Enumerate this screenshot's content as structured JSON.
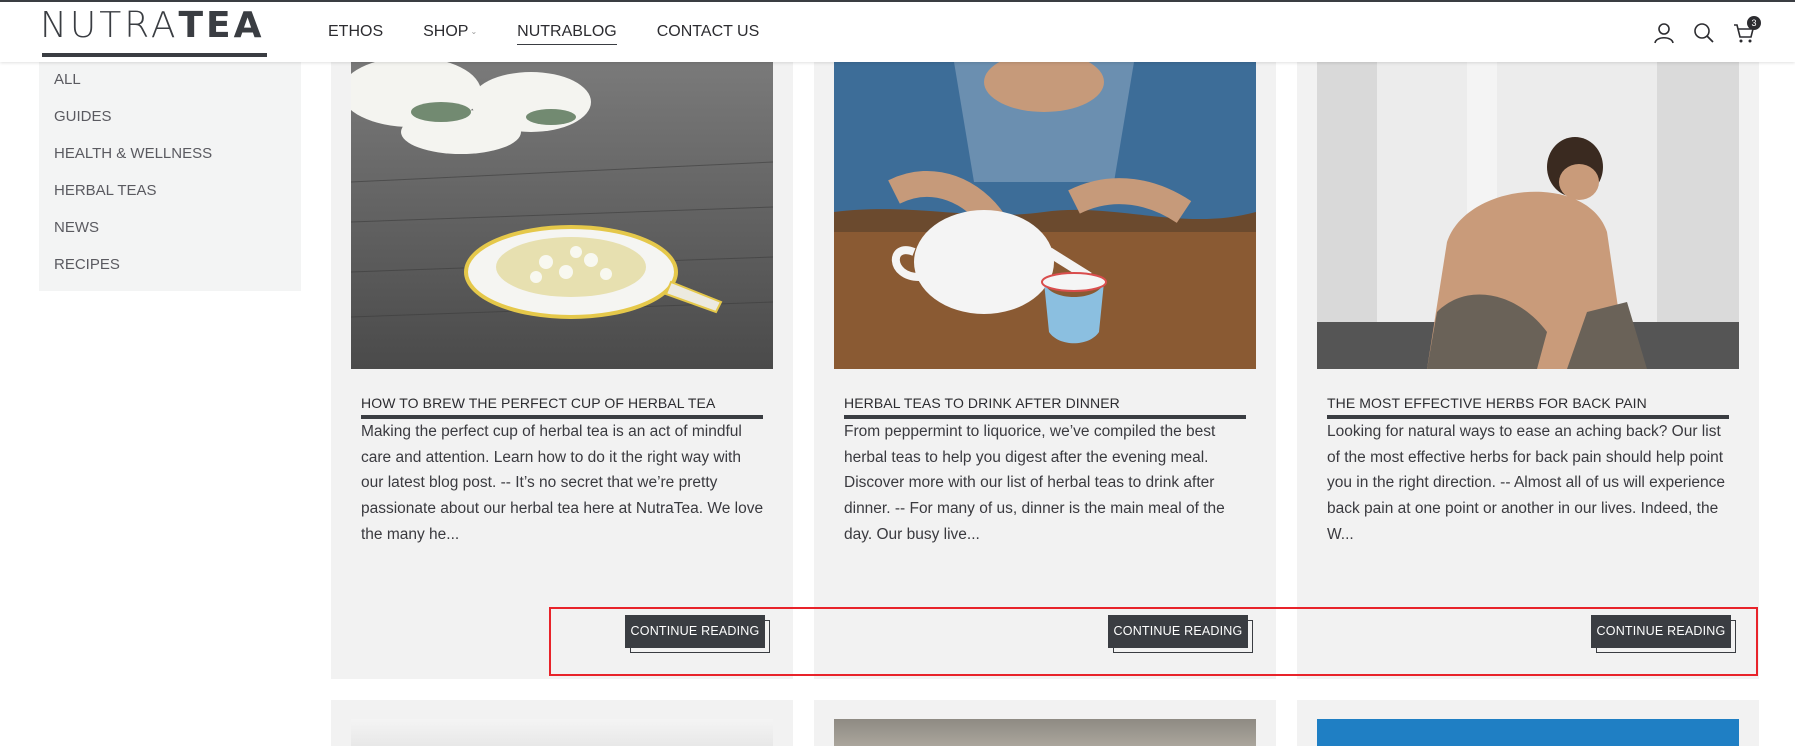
{
  "header": {
    "logo_thin": "NUTRA",
    "logo_bold": "TEA",
    "nav": [
      {
        "label": "ETHOS"
      },
      {
        "label": "SHOP"
      },
      {
        "label": "NUTRABLOG"
      },
      {
        "label": "CONTACT US"
      }
    ],
    "cart_count": "3"
  },
  "sidebar": {
    "items": [
      {
        "label": "ALL"
      },
      {
        "label": "GUIDES"
      },
      {
        "label": "HEALTH & WELLNESS"
      },
      {
        "label": "HERBAL TEAS"
      },
      {
        "label": "NEWS"
      },
      {
        "label": "RECIPES"
      }
    ]
  },
  "posts": [
    {
      "title": "HOW TO BREW THE PERFECT CUP OF HERBAL TEA",
      "excerpt": "Making the perfect cup of herbal tea is an act of mindful care and attention. Learn how to do it the right way with our latest blog post.  -- It’s no secret that we’re pretty passionate about our herbal tea here at NutraTea. We love the many he...",
      "button": "CONTINUE READING"
    },
    {
      "title": "HERBAL TEAS TO DRINK AFTER DINNER",
      "excerpt": "From peppermint to liquorice, we’ve compiled the best herbal teas to help you digest after the evening meal. Discover more with our list of herbal teas to drink after dinner.  -- For many of us, dinner is the main meal of the day. Our busy live...",
      "button": "CONTINUE READING"
    },
    {
      "title": "THE MOST EFFECTIVE HERBS FOR BACK PAIN",
      "excerpt": "Looking for natural ways to ease an aching back? Our list of the most effective herbs for back pain should help point you in the right direction.  -- Almost all of us will experience back pain at one point or another in our lives. Indeed, the W...",
      "button": "CONTINUE READING"
    }
  ],
  "colors": {
    "brand_dark": "#3a3d42",
    "card_bg": "#f2f2f2",
    "sidebar_bg": "#f3f4f4",
    "highlight": "#e8232a"
  }
}
